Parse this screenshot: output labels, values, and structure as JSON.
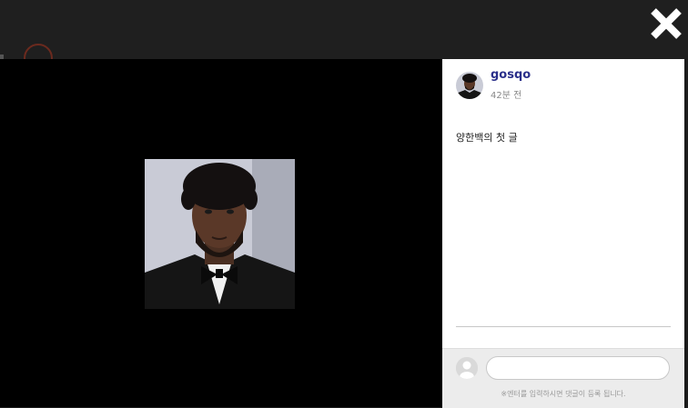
{
  "background_page": {
    "logo_icon": "circle-logo-icon"
  },
  "modal": {
    "close_icon": "close-x-icon",
    "photo": {
      "description_icon": "profile-photo",
      "alt": ""
    },
    "author": {
      "username": "gosqo",
      "time_ago": "42분 전",
      "avatar_icon": "user-avatar-icon"
    },
    "post": {
      "text": "양한백의 첫 글"
    },
    "comment": {
      "avatar_icon": "default-avatar-icon",
      "input_value": "",
      "placeholder": "",
      "hint": "※엔터를 입력하시면 댓글이 등록 됩니다."
    }
  },
  "colors": {
    "overlay": "#1c1c1c",
    "viewer": "#000000",
    "panel": "#ffffff",
    "username": "#2a2f8a",
    "comment_bar": "#ececec"
  }
}
